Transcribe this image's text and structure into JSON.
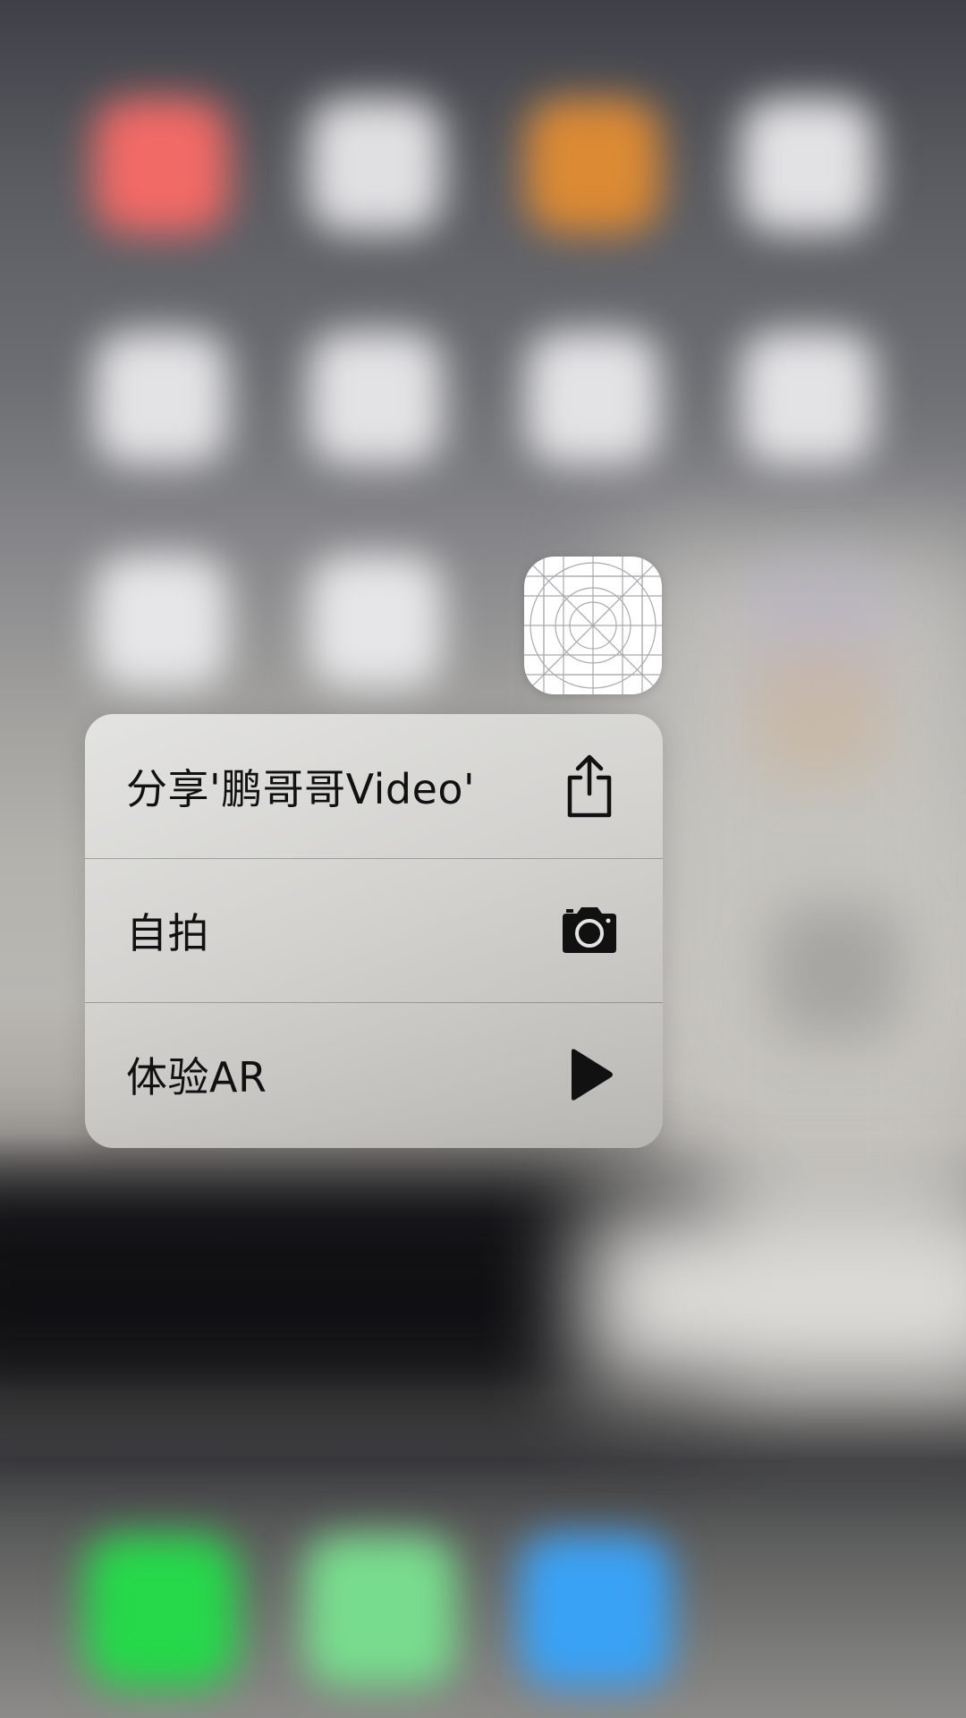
{
  "background": {
    "icon_rows": [
      [
        "#f26a66",
        "#e0e0e2",
        "#dc8a34",
        "#e2e2e4"
      ],
      [
        "#e3e3e5",
        "#e3e3e5",
        "#e3e3e5",
        "#e3e3e5"
      ],
      [
        "#e6e6e8",
        "#e6e6e8"
      ]
    ],
    "dock_colors": [
      "#25d94a",
      "#78dc8e",
      "#3aa2f5"
    ]
  },
  "app_icon": {
    "icon": "app-icon-template-grid",
    "color": "#ffffff"
  },
  "quick_actions": [
    {
      "label": "分享'鹏哥哥Video'",
      "icon": "share-icon"
    },
    {
      "label": "自拍",
      "icon": "camera-icon"
    },
    {
      "label": "体验AR",
      "icon": "play-icon"
    }
  ]
}
